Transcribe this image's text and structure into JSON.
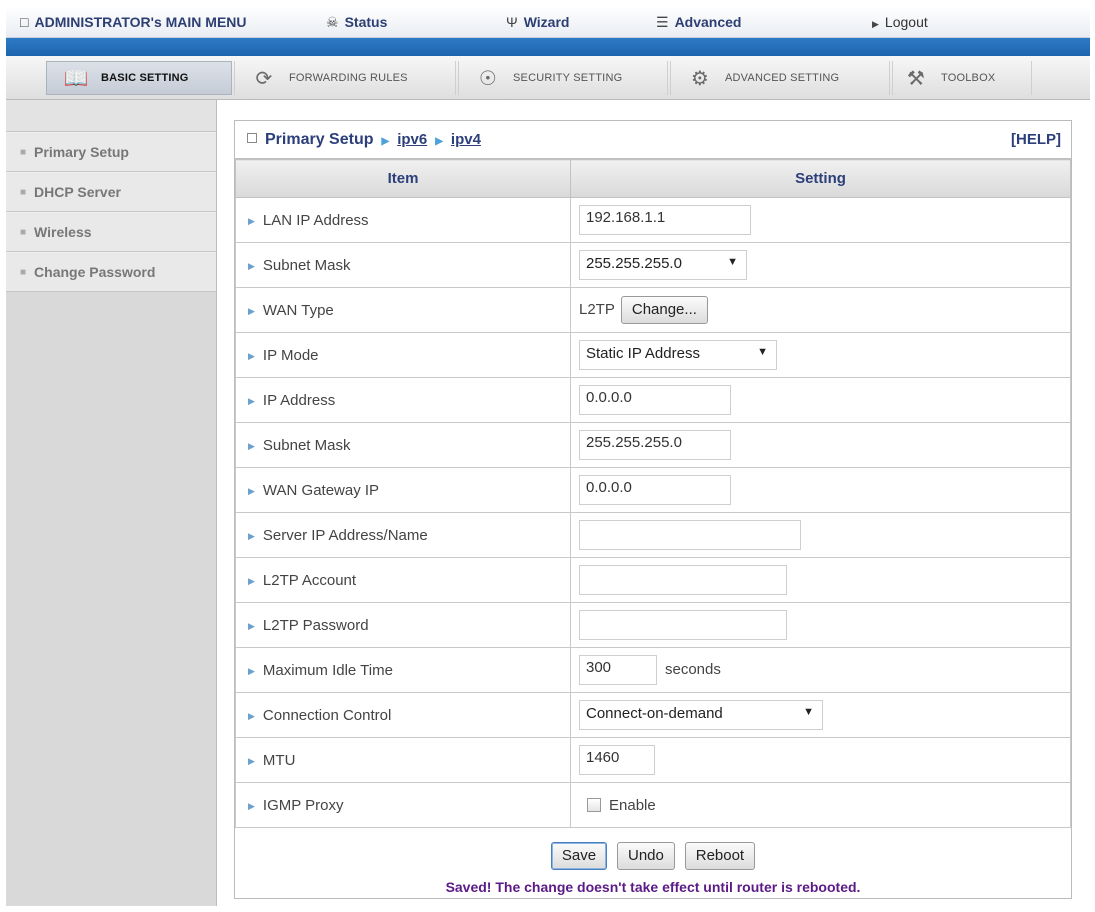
{
  "topmenu": {
    "admin_label": "ADMINISTRATOR's MAIN MENU",
    "status_label": "Status",
    "wizard_label": "Wizard",
    "advanced_label": "Advanced",
    "logout_label": "Logout"
  },
  "tabs": {
    "basic": "BASIC SETTING",
    "forwarding": "FORWARDING RULES",
    "security": "SECURITY SETTING",
    "advanced": "ADVANCED SETTING",
    "toolbox": "TOOLBOX"
  },
  "sidebar": {
    "items": [
      "Primary Setup",
      "DHCP Server",
      "Wireless",
      "Change Password"
    ]
  },
  "main": {
    "crumb_title": "Primary Setup",
    "crumb_ipv6": "ipv6",
    "crumb_ipv4": "ipv4",
    "help": "[HELP]",
    "col_item": "Item",
    "col_setting": "Setting"
  },
  "rows": {
    "lan_ip": {
      "label": "LAN IP Address",
      "value": "192.168.1.1"
    },
    "lan_mask": {
      "label": "Subnet Mask",
      "value": "255.255.255.0"
    },
    "wan_type": {
      "label": "WAN Type",
      "value": "L2TP",
      "button": "Change..."
    },
    "ip_mode": {
      "label": "IP Mode",
      "value": "Static IP Address"
    },
    "ip_address": {
      "label": "IP Address",
      "value": "0.0.0.0"
    },
    "wan_mask": {
      "label": "Subnet Mask",
      "value": "255.255.255.0"
    },
    "gateway": {
      "label": "WAN Gateway IP",
      "value": "0.0.0.0"
    },
    "server": {
      "label": "Server IP Address/Name",
      "value": ""
    },
    "account": {
      "label": "L2TP Account",
      "value": ""
    },
    "password": {
      "label": "L2TP Password",
      "value": ""
    },
    "idle": {
      "label": "Maximum Idle Time",
      "value": "300",
      "unit": "seconds"
    },
    "conn": {
      "label": "Connection Control",
      "value": "Connect-on-demand"
    },
    "mtu": {
      "label": "MTU",
      "value": "1460"
    },
    "igmp": {
      "label": "IGMP Proxy",
      "checkbox_label": "Enable",
      "checked": false
    }
  },
  "footer": {
    "save": "Save",
    "undo": "Undo",
    "reboot": "Reboot",
    "message": "Saved! The change doesn't take effect until router is rebooted."
  },
  "colors": {
    "accent": "#2c3f7a",
    "strip": "#1d64ad",
    "message": "#5b1a86"
  }
}
